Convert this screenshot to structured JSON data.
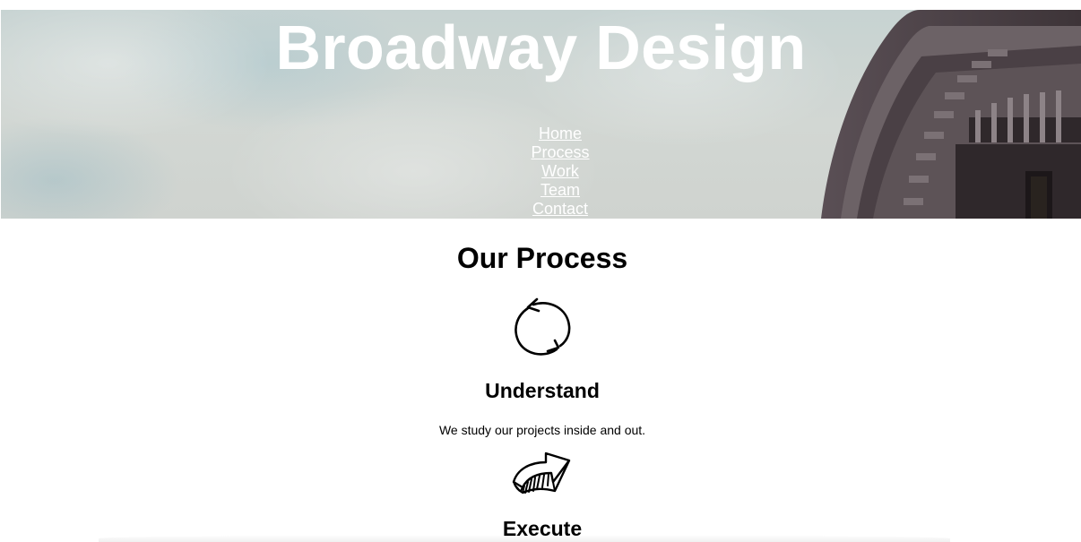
{
  "header": {
    "site_title": "Broadway Design",
    "nav": [
      {
        "label": "Home"
      },
      {
        "label": "Process"
      },
      {
        "label": "Work"
      },
      {
        "label": "Team"
      },
      {
        "label": "Contact"
      }
    ]
  },
  "process": {
    "title": "Our Process",
    "steps": [
      {
        "icon": "cycle-arrows-icon",
        "title": "Understand",
        "description": "We study our projects inside and out."
      },
      {
        "icon": "curved-arrow-icon",
        "title": "Execute"
      }
    ]
  },
  "colors": {
    "hero_text": "#ffffff",
    "body_text": "#000000",
    "background": "#ffffff"
  }
}
